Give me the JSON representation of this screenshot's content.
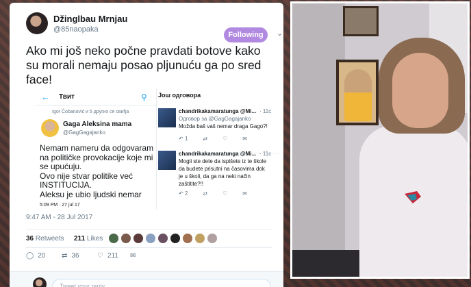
{
  "tweet": {
    "author_name": "Džinglbau Mrnjau",
    "author_handle": "@85naopaka",
    "follow_label": "Following",
    "text": "Ako mi još neko počne pravdati botove kako su morali nemaju posao pljunuću ga po sred face!",
    "timestamp": "9:47 AM - 28 Jul 2017",
    "retweets_count": "36",
    "retweets_label": "Retweets",
    "likes_count": "211",
    "likes_label": "Likes",
    "reply_count": "20",
    "retweet_action_count": "36",
    "like_action_count": "211",
    "reply_placeholder": "Tweet your reply"
  },
  "embedded_left": {
    "back_icon": "arrow-left-icon",
    "title": "Твит",
    "liked_by": "Igor Čobanović и 5 других се свиђа",
    "name": "Gaga Aleksina mama",
    "handle": "@GagGagajanko",
    "body_lines": [
      "Nemam nameru da odgovaram",
      "na političke provokacije koje mi",
      "se upućuju.",
      "Ovo nije stvar politike već",
      "INSTITUCIJA.",
      "Aleksu je ubio ljudski nemar"
    ],
    "time": "5:09 PM · 27 jul 17"
  },
  "embedded_right": {
    "header": "Још одговора",
    "replies": [
      {
        "name": "chandrikakamaratunga @Mi...",
        "time": "· 11с",
        "reply_to": "Одговор за @GagGagajanko",
        "lines": [
          "Možda baš vaš nemar draga Gago?!"
        ],
        "reply_count": "1"
      },
      {
        "name": "chandrikakamaratunga @Mi...",
        "time": "· 11с",
        "reply_to": "",
        "lines": [
          "Mogli ste dete da ispišete iz te škole",
          "da budete prisutni na časovima dok",
          "je u školi, da ga na neki način",
          "zaštitite?!!"
        ],
        "reply_count": "2"
      }
    ]
  },
  "colors": {
    "follow_button": "#b289e0",
    "link_blue": "#1da1f2",
    "text": "#14171a",
    "muted": "#657786"
  }
}
